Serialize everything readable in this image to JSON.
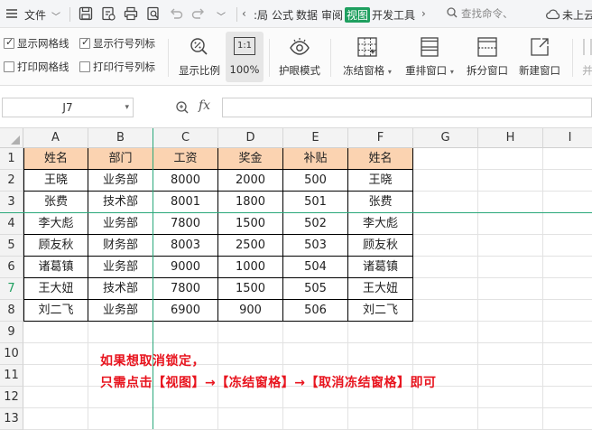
{
  "menu": {
    "file": "文件",
    "tabs": [
      ":局",
      "公式",
      "数据",
      "审阅",
      "视图",
      "开发工具"
    ],
    "active_tab": "视图",
    "search_placeholder": "查找命令、",
    "cloud_label": "未上云"
  },
  "ribbon": {
    "checkboxes": [
      {
        "label": "显示网格线",
        "checked": true
      },
      {
        "label": "显示行号列标",
        "checked": true
      },
      {
        "label": "打印网格线",
        "checked": false
      },
      {
        "label": "打印行号列标",
        "checked": false
      }
    ],
    "buttons": {
      "show_ratio": "显示比例",
      "zoom_100": "100%",
      "eye_mode": "护眼模式",
      "freeze": "冻结窗格",
      "rearrange": "重排窗口",
      "split": "拆分窗口",
      "new_window": "新建窗口",
      "more": "并"
    },
    "zoom_icon_text": "1:1"
  },
  "formula_bar": {
    "cell_ref": "J7",
    "fx": "fx",
    "value": ""
  },
  "sheet": {
    "columns": [
      "A",
      "B",
      "C",
      "D",
      "E",
      "F",
      "G",
      "H",
      "I"
    ],
    "rows": [
      "1",
      "2",
      "3",
      "4",
      "5",
      "6",
      "7",
      "8",
      "9",
      "10",
      "11",
      "12",
      "13"
    ],
    "headers": [
      "姓名",
      "部门",
      "工资",
      "奖金",
      "补贴",
      "姓名"
    ],
    "data": [
      [
        "王晓",
        "业务部",
        "8000",
        "2000",
        "500",
        "王晓"
      ],
      [
        "张费",
        "技术部",
        "8001",
        "1800",
        "501",
        "张费"
      ],
      [
        "李大彪",
        "业务部",
        "7800",
        "1500",
        "502",
        "李大彪"
      ],
      [
        "顾友秋",
        "财务部",
        "8003",
        "2500",
        "503",
        "顾友秋"
      ],
      [
        "诸葛镇",
        "业务部",
        "9000",
        "1000",
        "504",
        "诸葛镇"
      ],
      [
        "王大妞",
        "技术部",
        "7800",
        "1500",
        "505",
        "王大妞"
      ],
      [
        "刘二飞",
        "业务部",
        "6900",
        "900",
        "506",
        "刘二飞"
      ]
    ]
  },
  "note": {
    "line1": "如果想取消锁定，",
    "line2": "只需点击【视图】→【冻结窗格】→【取消冻结窗格】即可"
  },
  "colors": {
    "header_fill": "#fbd3b1",
    "freeze_line": "#2aa87a",
    "active_tab": "#1e9f5f",
    "note_red": "#e8141e"
  }
}
